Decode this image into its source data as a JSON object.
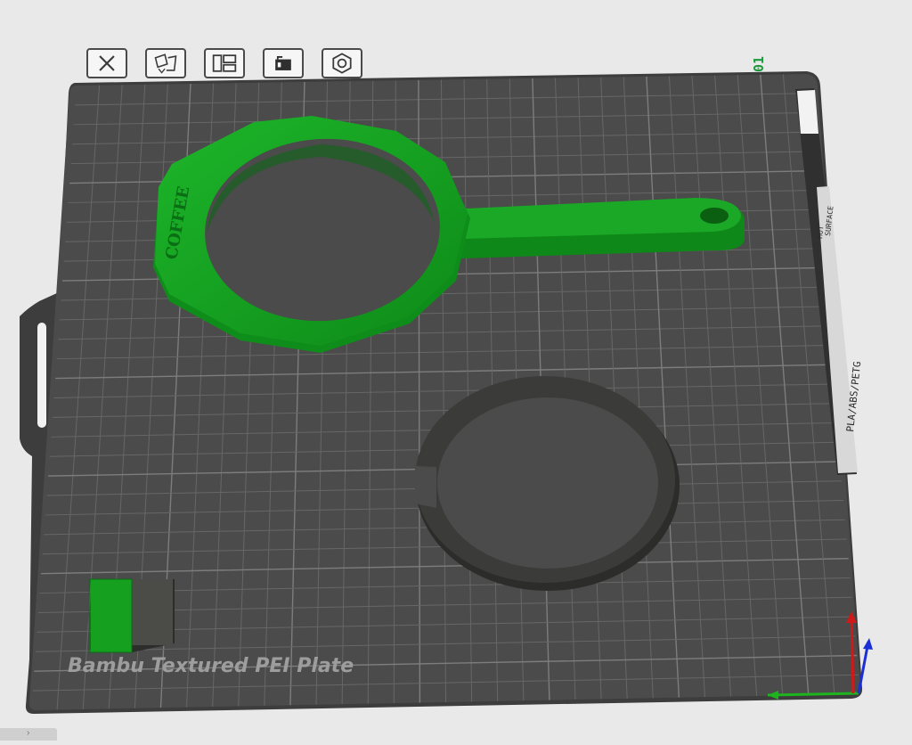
{
  "plate": {
    "name": "Bambu Textured PEI Plate",
    "index": "01",
    "side_label_material": "PLA/ABS/PETG",
    "side_label_warning_1": "HOT",
    "side_label_warning_2": "SURFACE"
  },
  "toolbar": {
    "buttons": [
      {
        "name": "delete-plate-button",
        "icon": "close-icon"
      },
      {
        "name": "arrange-button",
        "icon": "auto-arrange-icon"
      },
      {
        "name": "layout-button",
        "icon": "plate-layout-icon"
      },
      {
        "name": "lock-button",
        "icon": "lock-icon"
      },
      {
        "name": "plate-settings-button",
        "icon": "hex-nut-icon"
      }
    ]
  },
  "objects": {
    "handle_text": "COFFEE",
    "handle_color": "#15a11f",
    "ring_color": "#3b3b39",
    "block_colors": [
      "#15a11f",
      "#4b4b48"
    ]
  },
  "colors": {
    "background": "#e9e9e9",
    "plate": "#4a4b4a",
    "grid": "#6a6b6a",
    "accent": "#1a9a3a",
    "axis_x": "#1db41d",
    "axis_y": "#1c2fd6",
    "axis_z": "#d01a1a"
  }
}
